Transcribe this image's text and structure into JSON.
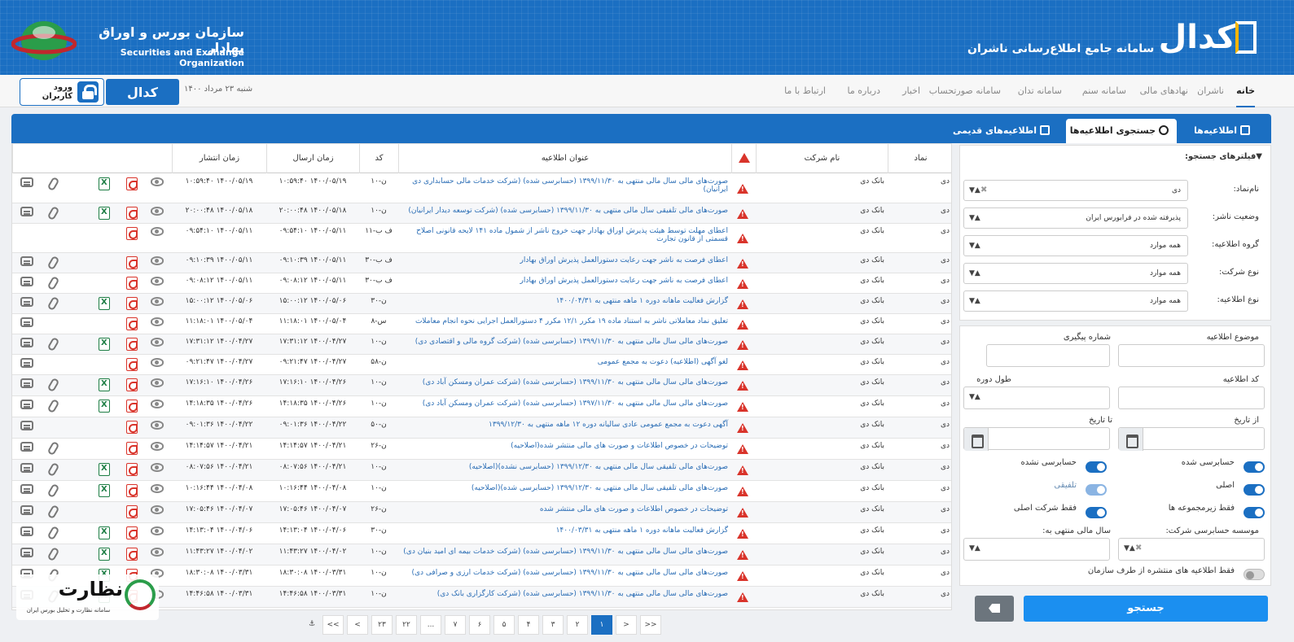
{
  "header": {
    "codal_brand": "کدال",
    "codal_subtitle": "سامانه جامع اطلاع‌رسانی ناشران",
    "seo_title": "سازمان بورس و اوراق بهادار",
    "seo_subtitle": "Securities and Exchange Organization"
  },
  "nav": {
    "items": [
      "خانه",
      "ناشران",
      "نهادهای مالی",
      "سامانه سنم",
      "سامانه تدان",
      "سامانه صورتحساب",
      "اخبار",
      "درباره ما",
      "ارتباط با ما"
    ],
    "date": "شنبه ۲۳ مرداد ۱۴۰۰",
    "codal_small": "کدال",
    "login": "ورود کاربران"
  },
  "tabs": {
    "items": [
      "اطلاعیه‌ها",
      "جستجوی اطلاعیه‌ها",
      "اطلاعیه‌های قدیمی"
    ]
  },
  "filters": {
    "title": "فیلترهای جستجو:",
    "symbol_label": "نام‌نماد:",
    "symbol_value": "دی",
    "status_label": "وضعیت ناشر:",
    "status_value": "پذیرفته شده در فرابورس ایران",
    "group_label": "گروه اطلاعیه:",
    "group_value": "همه موارد",
    "company_type_label": "نوع شرکت:",
    "company_type_value": "همه موارد",
    "letter_type_label": "نوع اطلاعیه:",
    "letter_type_value": "همه موارد"
  },
  "form": {
    "subject_label": "موضوع اطلاعیه",
    "tracking_label": "شماره پیگیری",
    "code_label": "کد اطلاعیه",
    "period_label": "طول دوره",
    "from_label": "از تاریخ",
    "to_label": "تا تاریخ",
    "audited": "حسابرسی شده",
    "not_audited": "حسابرسی نشده",
    "original": "اصلی",
    "consolidated": "تلفیقی",
    "subsidiaries": "فقط زیرمجموعه ها",
    "main_only": "فقط شرکت اصلی",
    "auditor_label": "موسسه حسابرسی شرکت:",
    "fiscal_label": "سال مالی منتهی به:",
    "org_only": "فقط اطلاعیه های منتشره از طرف سازمان",
    "search": "جستجو"
  },
  "table": {
    "headers": {
      "symbol": "نماد",
      "company": "نام شرکت",
      "title": "عنوان اطلاعیه",
      "code": "کد",
      "sent": "زمان ارسال",
      "published": "زمان انتشار"
    },
    "rows": [
      {
        "symbol": "دی",
        "company": "بانک دی",
        "title": "صورت‌های مالی سال مالی منتهی به ۱۳۹۹/۱۱/۳۰ (حسابرسی شده) (شرکت خدمات مالی حسابداری دی ایرانیان)",
        "code": "ن-۱۰",
        "sent": "۱۴۰۰/۰۵/۱۹ ۱۰:۵۹:۴۰",
        "pub": "۱۴۰۰/۰۵/۱۹ ۱۰:۵۹:۴۰",
        "xls": true,
        "h": 36
      },
      {
        "symbol": "دی",
        "company": "بانک دی",
        "title": "صورت‌های مالی تلفیقی سال مالی منتهی به ۱۳۹۹/۱۱/۳۰ (حسابرسی شده) (شرکت توسعه دیدار ایرانیان)",
        "code": "ن-۱۰",
        "sent": "۱۴۰۰/۰۵/۱۸ ۲۰:۰۰:۴۸",
        "pub": "۱۴۰۰/۰۵/۱۸ ۲۰:۰۰:۴۸",
        "xls": true,
        "h": 25
      },
      {
        "symbol": "دی",
        "company": "بانک دی",
        "title": "اعطای مهلت توسط هیئت پذیرش اوراق بهادار جهت خروج ناشر از شمول ماده ۱۴۱ لایحه قانونی اصلاح قسمتی از قانون تجارت",
        "code": "ف ب-۱۱",
        "sent": "۱۴۰۰/۰۵/۱۱ ۰۹:۵۴:۱۰",
        "pub": "۱۴۰۰/۰۵/۱۱ ۰۹:۵۴:۱۰",
        "xls": false,
        "h": 36
      },
      {
        "symbol": "دی",
        "company": "بانک دی",
        "title": "اعطای فرصت به ناشر جهت رعایت دستورالعمل پذیرش اوراق بهادار",
        "code": "ف ب-۳۰",
        "sent": "۱۴۰۰/۰۵/۱۱ ۰۹:۱۰:۳۹",
        "pub": "۱۴۰۰/۰۵/۱۱ ۰۹:۱۰:۳۹",
        "xls": false,
        "h": 25
      },
      {
        "symbol": "دی",
        "company": "بانک دی",
        "title": "اعطای فرصت به ناشر جهت رعایت دستورالعمل پذیرش اوراق بهادار",
        "code": "ف ب-۳۰",
        "sent": "۱۴۰۰/۰۵/۱۱ ۰۹:۰۸:۱۲",
        "pub": "۱۴۰۰/۰۵/۱۱ ۰۹:۰۸:۱۲",
        "xls": false,
        "h": 25
      },
      {
        "symbol": "دی",
        "company": "بانک دی",
        "title": "گزارش فعالیت ماهانه دوره ۱ ماهه منتهی به ۱۴۰۰/۰۴/۳۱",
        "code": "ن-۳۰",
        "sent": "۱۴۰۰/۰۵/۰۶ ۱۵:۰۰:۱۲",
        "pub": "۱۴۰۰/۰۵/۰۶ ۱۵:۰۰:۱۲",
        "xls": true,
        "h": 25
      },
      {
        "symbol": "دی",
        "company": "بانک دی",
        "title": "تعلیق نماد معاملاتی ناشر به استناد ماده ۱۹ مکرر ۱۲/۱ مکرر ۴ دستورالعمل اجرایی نحوه انجام معاملات",
        "code": "س-۸",
        "sent": "۱۴۰۰/۰۵/۰۴ ۱۱:۱۸:۰۱",
        "pub": "۱۴۰۰/۰۵/۰۴ ۱۱:۱۸:۰۱",
        "xls": false,
        "h": 25
      },
      {
        "symbol": "دی",
        "company": "بانک دی",
        "title": "صورت‌های مالی سال مالی منتهی به ۱۳۹۹/۱۱/۳۰ (حسابرسی شده) (شرکت گروه مالی و اقتصادی دی)",
        "code": "ن-۱۰",
        "sent": "۱۴۰۰/۰۴/۲۷ ۱۷:۳۱:۱۲",
        "pub": "۱۴۰۰/۰۴/۲۷ ۱۷:۳۱:۱۲",
        "xls": true,
        "h": 25
      },
      {
        "symbol": "دی",
        "company": "بانک دی",
        "title": "لغو آگهی (اطلاعیه) دعوت به مجمع عمومی",
        "code": "ن-۵۸",
        "sent": "۱۴۰۰/۰۴/۲۷ ۰۹:۲۱:۴۷",
        "pub": "۱۴۰۰/۰۴/۲۷ ۰۹:۲۱:۴۷",
        "xls": false,
        "h": 25
      },
      {
        "symbol": "دی",
        "company": "بانک دی",
        "title": "صورت‌های مالی سال مالی منتهی به ۱۳۹۹/۱۱/۳۰ (حسابرسی شده) (شرکت عمران ومسکن آباد دی)",
        "code": "ن-۱۰",
        "sent": "۱۴۰۰/۰۴/۲۶ ۱۷:۱۶:۱۰",
        "pub": "۱۴۰۰/۰۴/۲۶ ۱۷:۱۶:۱۰",
        "xls": true,
        "h": 26
      },
      {
        "symbol": "دی",
        "company": "بانک دی",
        "title": "صورت‌های مالی سال مالی منتهی به ۱۳۹۷/۱۱/۳۰ (حسابرسی شده) (شرکت عمران ومسکن آباد دی)",
        "code": "ن-۱۰",
        "sent": "۱۴۰۰/۰۴/۲۶ ۱۴:۱۸:۳۵",
        "pub": "۱۴۰۰/۰۴/۲۶ ۱۴:۱۸:۳۵",
        "xls": true,
        "h": 26
      },
      {
        "symbol": "دی",
        "company": "بانک دی",
        "title": "آگهی دعوت به مجمع عمومی عادی سالیانه دوره ۱۲ ماهه منتهی به ۱۳۹۹/۱۲/۳۰",
        "code": "ن-۵۰",
        "sent": "۱۴۰۰/۰۴/۲۲ ۰۹:۰۱:۳۶",
        "pub": "۱۴۰۰/۰۴/۲۲ ۰۹:۰۱:۳۶",
        "xls": false,
        "h": 26
      },
      {
        "symbol": "دی",
        "company": "بانک دی",
        "title": "توضیحات در خصوص اطلاعات و صورت های مالی منتشر شده(اصلاحیه)",
        "code": "ن-۲۶",
        "sent": "۱۴۰۰/۰۴/۲۱ ۱۴:۱۴:۵۷",
        "pub": "۱۴۰۰/۰۴/۲۱ ۱۴:۱۴:۵۷",
        "xls": false,
        "h": 26
      },
      {
        "symbol": "دی",
        "company": "بانک دی",
        "title": "صورت‌های مالی تلفیقی سال مالی منتهی به ۱۳۹۹/۱۲/۳۰ (حسابرسی نشده)(اصلاحیه)",
        "code": "ن-۱۰",
        "sent": "۱۴۰۰/۰۴/۲۱ ۰۸:۰۷:۵۶",
        "pub": "۱۴۰۰/۰۴/۲۱ ۰۸:۰۷:۵۶",
        "xls": true,
        "h": 26
      },
      {
        "symbol": "دی",
        "company": "بانک دی",
        "title": "صورت‌های مالی تلفیقی سال مالی منتهی به ۱۳۹۹/۱۲/۳۰ (حسابرسی شده)(اصلاحیه)",
        "code": "ن-۱۰",
        "sent": "۱۴۰۰/۰۴/۰۸ ۱۰:۱۶:۴۴",
        "pub": "۱۴۰۰/۰۴/۰۸ ۱۰:۱۶:۴۴",
        "xls": true,
        "h": 26
      },
      {
        "symbol": "دی",
        "company": "بانک دی",
        "title": "توضیحات در خصوص اطلاعات و صورت های مالی منتشر شده",
        "code": "ن-۲۶",
        "sent": "۱۴۰۰/۰۴/۰۷ ۱۷:۰۵:۴۶",
        "pub": "۱۴۰۰/۰۴/۰۷ ۱۷:۰۵:۴۶",
        "xls": false,
        "h": 26
      },
      {
        "symbol": "دی",
        "company": "بانک دی",
        "title": "گزارش فعالیت ماهانه دوره ۱ ماهه منتهی به ۱۴۰۰/۰۳/۳۱",
        "code": "ن-۳۰",
        "sent": "۱۴۰۰/۰۴/۰۶ ۱۴:۱۳:۰۴",
        "pub": "۱۴۰۰/۰۴/۰۶ ۱۴:۱۳:۰۴",
        "xls": true,
        "h": 26
      },
      {
        "symbol": "دی",
        "company": "بانک دی",
        "title": "صورت‌های مالی سال مالی منتهی به ۱۳۹۹/۱۱/۳۰ (حسابرسی شده) (شرکت خدمات بیمه ای امید بنیان دی)",
        "code": "ن-۱۰",
        "sent": "۱۴۰۰/۰۴/۰۲ ۱۱:۴۳:۲۷",
        "pub": "۱۴۰۰/۰۴/۰۲ ۱۱:۴۳:۲۷",
        "xls": true,
        "h": 26
      },
      {
        "symbol": "دی",
        "company": "بانک دی",
        "title": "صورت‌های مالی سال مالی منتهی به ۱۳۹۹/۱۱/۳۰ (حسابرسی شده) (شرکت خدمات ارزی و صرافی دی)",
        "code": "ن-۱۰",
        "sent": "۱۴۰۰/۰۳/۳۱ ۱۸:۳۰:۰۸",
        "pub": "۱۴۰۰/۰۳/۳۱ ۱۸:۳۰:۰۸",
        "xls": true,
        "h": 26
      },
      {
        "symbol": "دی",
        "company": "بانک دی",
        "title": "صورت‌های مالی سال مالی منتهی به ۱۳۹۹/۱۱/۳۰ (حسابرسی شده) (شرکت کارگزاری بانک دی)",
        "code": "ن-۱۰",
        "sent": "۱۴۰۰/۰۳/۳۱ ۱۴:۴۶:۵۸",
        "pub": "۱۴۰۰/۰۳/۳۱ ۱۴:۴۶:۵۸",
        "xls": true,
        "h": 26
      }
    ]
  },
  "pager": {
    "items": [
      ">>",
      ">",
      "۱",
      "۲",
      "۳",
      "۴",
      "۵",
      "۶",
      "۷",
      "...",
      "۲۲",
      "۲۳",
      "<",
      "<<"
    ],
    "active_index": 2
  },
  "watermark": {
    "brand": "نظارت",
    "subtitle": "سامانه نظارت و تحلیل بورس ایران"
  }
}
